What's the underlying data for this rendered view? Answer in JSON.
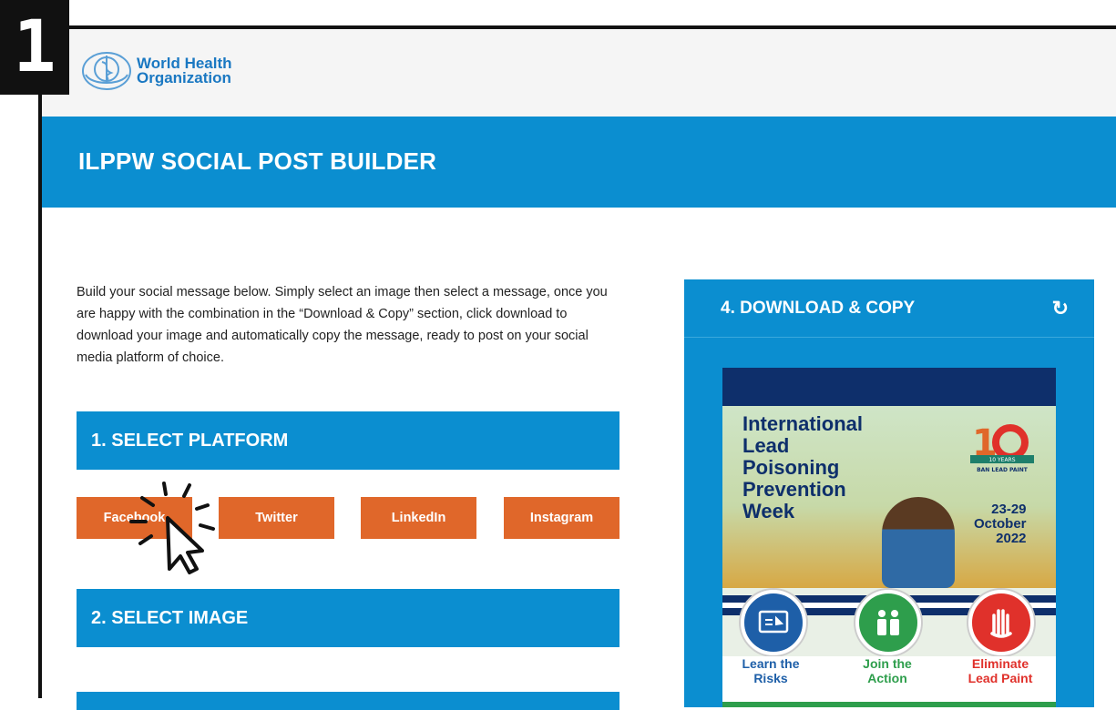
{
  "step_badge": "1",
  "logo": {
    "line1": "World Health",
    "line2": "Organization"
  },
  "banner_title": "ILPPW SOCIAL POST BUILDER",
  "intro": "Build your social message below. Simply select an image then select a message, once you are happy with the combination in the “Download & Copy” section, click download to download your image and automatically copy the message, ready to post on your social media platform of choice.",
  "sections": {
    "platform": "1. SELECT PLATFORM",
    "image": "2. SELECT IMAGE"
  },
  "platforms": [
    "Facebook",
    "Twitter",
    "LinkedIn",
    "Instagram"
  ],
  "download": {
    "title": "4. DOWNLOAD & COPY",
    "reset_icon": "reset-icon",
    "poster": {
      "title": [
        "International",
        "Lead",
        "Poisoning",
        "Prevention",
        "Week"
      ],
      "dates": [
        "23-29",
        "October",
        "2022"
      ],
      "logo_text": {
        "ribbon": "10 YEARS",
        "sub": "BAN LEAD PAINT"
      },
      "captions": [
        {
          "l1": "Learn the",
          "l2": "Risks",
          "color": "#1e5fa8"
        },
        {
          "l1": "Join the",
          "l2": "Action",
          "color": "#2e9e4c"
        },
        {
          "l1": "Eliminate",
          "l2": "Lead Paint",
          "color": "#e0312b"
        }
      ]
    }
  },
  "colors": {
    "primary": "#0b8ed0",
    "button": "#e0672a",
    "navy": "#0e2f6b"
  }
}
